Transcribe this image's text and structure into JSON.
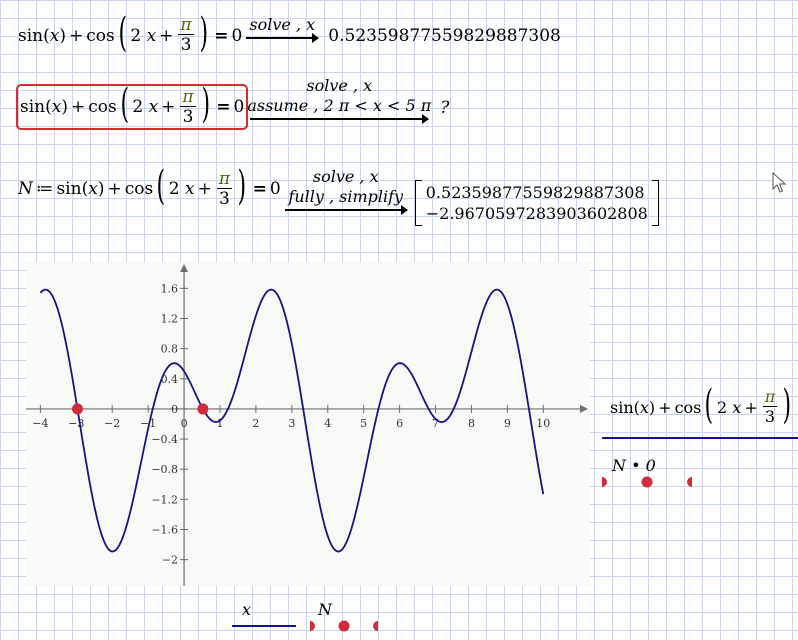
{
  "lines": [
    {
      "lhs": {
        "sin": "sin",
        "cos": "cos",
        "var": "x",
        "coef": "2",
        "pi": "π",
        "den": "3",
        "eq": "=",
        "zero": "0"
      },
      "keywords": [
        "solve , x"
      ],
      "result": "0.52359877559829887308"
    },
    {
      "lhs": {
        "sin": "sin",
        "cos": "cos",
        "var": "x",
        "coef": "2",
        "pi": "π",
        "den": "3",
        "eq": "=",
        "zero": "0"
      },
      "keywords": [
        "solve , x",
        "assume , 2 π < x < 5 π"
      ],
      "result": "?"
    },
    {
      "def": {
        "name": "N",
        "assign": "≔"
      },
      "lhs": {
        "sin": "sin",
        "cos": "cos",
        "var": "x",
        "coef": "2",
        "pi": "π",
        "den": "3",
        "eq": "=",
        "zero": "0"
      },
      "keywords": [
        "solve , x",
        "fully , simplify"
      ],
      "result_vector": [
        "0.52359877559829887308",
        "−2.9670597283903602808"
      ]
    }
  ],
  "plot": {
    "y_trace_label": {
      "sin": "sin",
      "cos": "cos",
      "var": "x",
      "coef": "2",
      "pi": "π",
      "den": "3"
    },
    "y_trace2_label": "N • 0",
    "x_trace_label": "x",
    "x2_trace_label": "N",
    "colors": {
      "curve": "#141485",
      "points": "#d22b3a",
      "axis": "#6e6e6e"
    }
  },
  "chart_data": {
    "type": "line",
    "title": "",
    "xlabel": "x",
    "ylabel": "",
    "xlim": [
      -4.4,
      11.3
    ],
    "ylim": [
      -2.35,
      1.95
    ],
    "x_ticks": [
      -4,
      -3,
      -2,
      -1,
      0,
      1,
      2,
      3,
      4,
      5,
      6,
      7,
      8,
      9,
      10
    ],
    "y_ticks": [
      -2,
      -1.6,
      -1.2,
      -0.8,
      -0.4,
      0,
      0.4,
      0.8,
      1.2,
      1.6
    ],
    "x_tick_labels": [
      "−4",
      "−3",
      "−2",
      "−1",
      "0",
      "1",
      "2",
      "3",
      "4",
      "5",
      "6",
      "7",
      "8",
      "9",
      "10"
    ],
    "y_tick_labels": [
      "−2",
      "−1.6",
      "−1.2",
      "−0.8",
      "−0.4",
      "0",
      "0.4",
      "0.8",
      "1.2",
      "1.6"
    ],
    "series": [
      {
        "function": "sin(x)+cos(2x+π/3)",
        "x_range": [
          -4,
          10
        ]
      },
      {
        "points": [
          [
            0.5236,
            0
          ],
          [
            -2.9671,
            0
          ]
        ]
      }
    ],
    "grid": false
  }
}
